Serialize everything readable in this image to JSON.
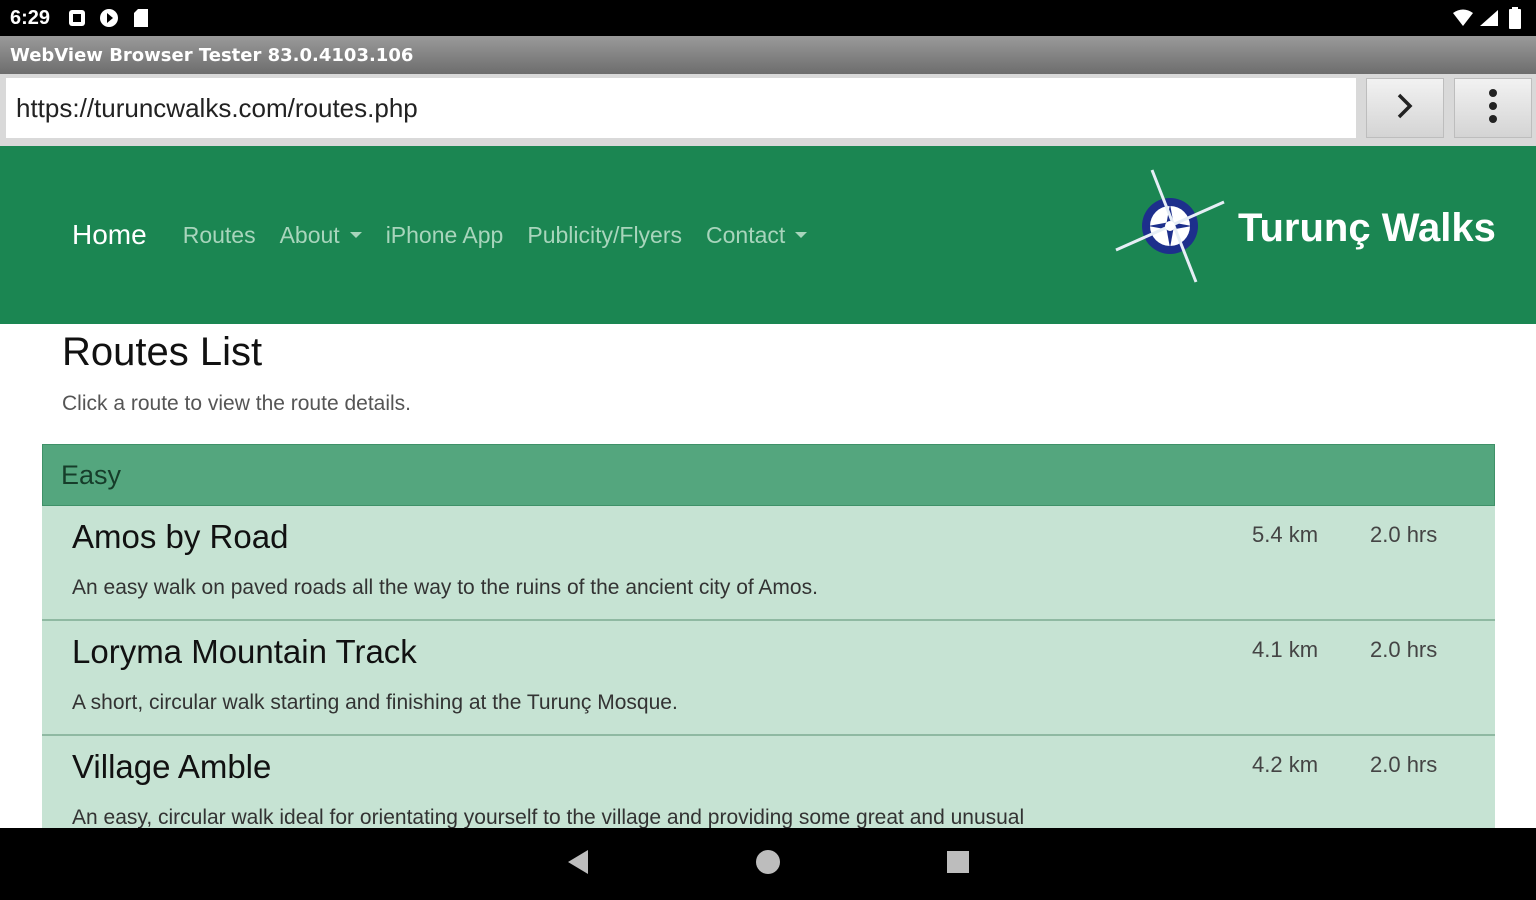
{
  "status_bar": {
    "time": "6:29"
  },
  "window": {
    "title": "WebView Browser Tester 83.0.4103.106"
  },
  "browser": {
    "url": "https://turuncwalks.com/routes.php",
    "go_icon": "chevron-right-icon",
    "menu_icon": "more-vert-icon"
  },
  "site": {
    "nav": [
      {
        "label": "Home"
      },
      {
        "label": "Routes"
      },
      {
        "label": "About"
      },
      {
        "label": "iPhone App"
      },
      {
        "label": "Publicity/Flyers"
      },
      {
        "label": "Contact"
      }
    ],
    "brand": "Turunç Walks",
    "colors": {
      "navbar": "#1b8652",
      "section_header": "#54a67e",
      "route_row": "#c6e3d3"
    }
  },
  "page": {
    "title": "Routes List",
    "subtitle": "Click a route to view the route details.",
    "section": "Easy",
    "routes": [
      {
        "name": "Amos by Road",
        "distance": "5.4 km",
        "duration": "2.0 hrs",
        "description": "An easy walk on paved roads all the way to the ruins of the ancient city of Amos."
      },
      {
        "name": "Loryma Mountain Track",
        "distance": "4.1 km",
        "duration": "2.0 hrs",
        "description": "A short, circular walk starting and finishing at the Turunç Mosque."
      },
      {
        "name": "Village Amble",
        "distance": "4.2 km",
        "duration": "2.0 hrs",
        "description": "An easy, circular walk ideal for orientating yourself to the village and providing some great and unusual"
      }
    ]
  }
}
